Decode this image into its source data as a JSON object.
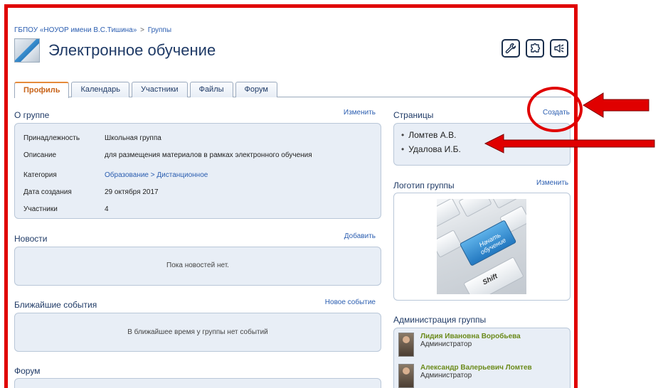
{
  "breadcrumb": {
    "org": "ГБПОУ «НОУОР имени В.С.Тишина»",
    "separator": ">",
    "current": "Группы"
  },
  "header": {
    "title": "Электронное обучение",
    "tools": [
      "wrench-icon",
      "puzzle-icon",
      "sound-icon"
    ]
  },
  "tabs": [
    {
      "label": "Профиль",
      "active": true
    },
    {
      "label": "Календарь",
      "active": false
    },
    {
      "label": "Участники",
      "active": false
    },
    {
      "label": "Файлы",
      "active": false
    },
    {
      "label": "Форум",
      "active": false
    }
  ],
  "about": {
    "title": "О группе",
    "action": "Изменить",
    "rows": [
      {
        "label": "Принадлежность",
        "value": "Школьная группа"
      },
      {
        "label": "Описание",
        "value": "для размещения материалов в рамках электронного обучения"
      },
      {
        "label": "Категория",
        "value": "Образование > Дистанционное"
      },
      {
        "label": "Дата создания",
        "value": "29 октября 2017"
      },
      {
        "label": "Участники",
        "value": "4"
      }
    ]
  },
  "news": {
    "title": "Новости",
    "action": "Добавить",
    "empty": "Пока новостей нет."
  },
  "events": {
    "title": "Ближайшие события",
    "action": "Новое событие",
    "empty": "В ближайшее время у группы нет событий"
  },
  "forum": {
    "title": "Форум"
  },
  "pages": {
    "title": "Страницы",
    "action": "Создать",
    "items": [
      "Ломтев А.В.",
      "Удалова И.Б."
    ]
  },
  "group_logo": {
    "title": "Логотип группы",
    "action": "Изменить",
    "key_text": "Начать обучение",
    "shift_text": "Shift"
  },
  "admins": {
    "title": "Администрация группы",
    "items": [
      {
        "name": "Лидия Ивановна Воробьева",
        "role": "Администратор"
      },
      {
        "name": "Александр Валерьевич Ломтев",
        "role": "Администратор"
      }
    ]
  },
  "annotation_color": "#e00000"
}
